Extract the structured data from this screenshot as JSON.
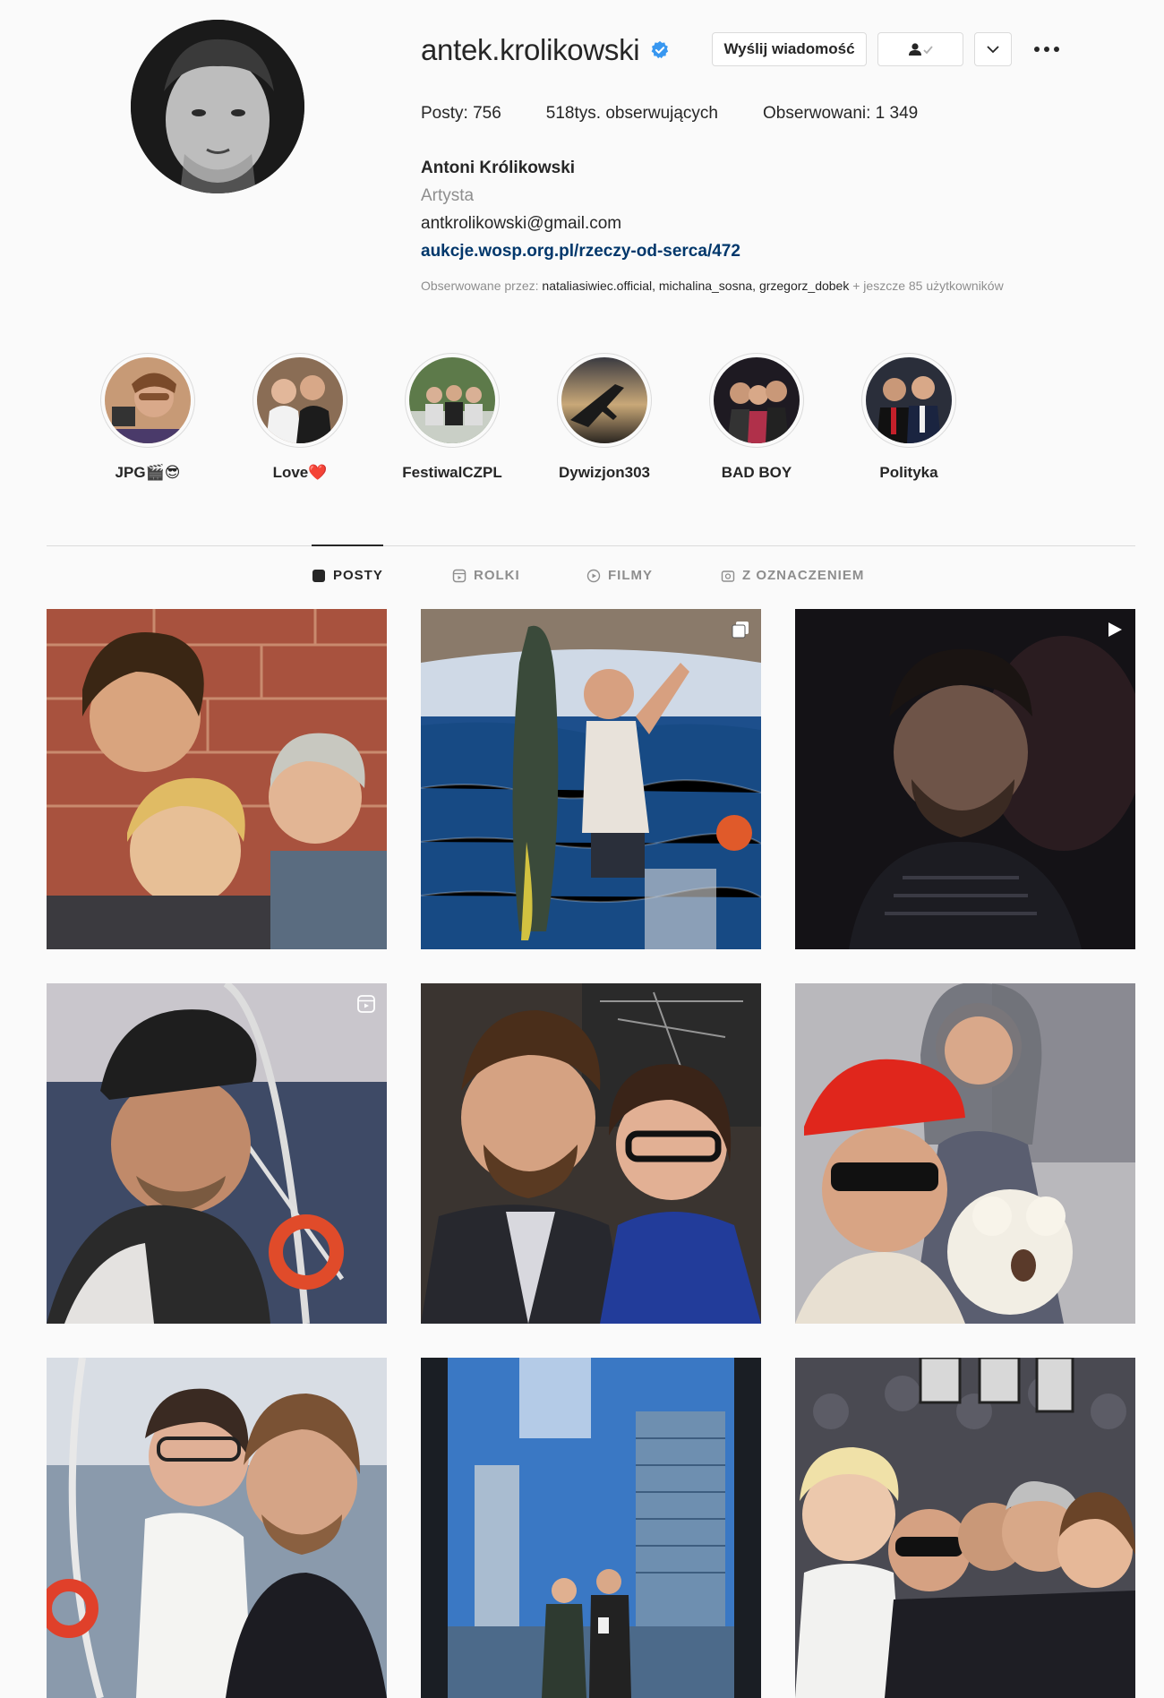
{
  "profile": {
    "username": "antek.krolikowski",
    "verified": true,
    "buttons": {
      "message": "Wyślij wiadomość",
      "follow_icon": "user-check-icon",
      "caret_icon": "chevron-down-icon",
      "more_icon": "more-horizontal-icon"
    },
    "stats": {
      "posts": "Posty: 756",
      "followers": "518tys. obserwujących",
      "following": "Obserwowani: 1 349"
    },
    "full_name": "Antoni Królikowski",
    "category": "Artysta",
    "email": "antkrolikowski@gmail.com",
    "link": "aukcje.wosp.org.pl/rzeczy-od-serca/472",
    "followed_by_prefix": "Obserwowane przez: ",
    "followed_by_names": "nataliasiwiec.official, michalina_sosna, grzegorz_dobek",
    "followed_by_suffix": " + jeszcze 85 użytkowników"
  },
  "highlights": [
    {
      "label": "JPG🎬😎"
    },
    {
      "label": "Love❤️"
    },
    {
      "label": "FestiwalCZPL"
    },
    {
      "label": "Dywizjon303"
    },
    {
      "label": "BAD BOY"
    },
    {
      "label": "Polityka"
    }
  ],
  "tabs": [
    {
      "label": "POSTY",
      "icon": "grid-icon",
      "active": true
    },
    {
      "label": "ROLKI",
      "icon": "reels-icon",
      "active": false
    },
    {
      "label": "FILMY",
      "icon": "play-circle-icon",
      "active": false
    },
    {
      "label": "Z OZNACZENIEM",
      "icon": "tagged-icon",
      "active": false
    }
  ],
  "posts": [
    {
      "type": "photo"
    },
    {
      "type": "carousel",
      "badge_icon": "carousel-icon"
    },
    {
      "type": "video",
      "badge_icon": "video-icon"
    },
    {
      "type": "reel",
      "badge_icon": "reel-icon"
    },
    {
      "type": "photo"
    },
    {
      "type": "photo"
    },
    {
      "type": "photo"
    },
    {
      "type": "photo"
    },
    {
      "type": "photo"
    }
  ],
  "colors": {
    "link": "#00376b",
    "verified_badge": "#3897f0",
    "muted_text": "#8e8e8e",
    "border": "#dbdbdb"
  }
}
